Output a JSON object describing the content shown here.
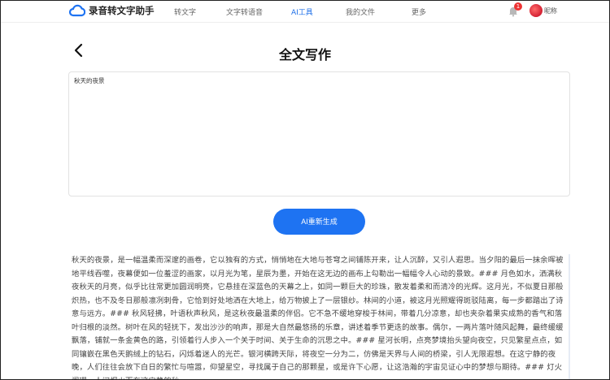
{
  "app": {
    "logo_text": "录音转文字助手"
  },
  "nav": {
    "items": [
      {
        "label": "转文字",
        "active": false
      },
      {
        "label": "文字转语音",
        "active": false
      },
      {
        "label": "AI工具",
        "active": true
      },
      {
        "label": "我的文件",
        "active": false
      },
      {
        "label": "更多",
        "active": false
      }
    ]
  },
  "user": {
    "notifications": "1",
    "nickname": "昵称"
  },
  "page": {
    "title": "全文写作"
  },
  "input": {
    "value": "秋天的夜景"
  },
  "actions": {
    "regenerate_label": "AI重新生成"
  },
  "result": {
    "text": "秋天的夜景，是一幅温柔而深邃的画卷，它以独有的方式，悄悄地在大地与苍穹之间铺陈开来，让人沉醉，又引人遐思。当夕阳的最后一抹余晖被地平线吞噬，夜幕便如一位羞涩的画家，以月光为笔，星辰为墨，开始在这无边的画布上勾勒出一幅幅令人心动的景致。### 月色如水，洒满秋夜秋天的月亮，似乎比往常更加圆润明亮，它悬挂在深蓝色的天幕之上，如同一颗巨大的珍珠，散发着柔和而清冷的光辉。这月光，不似夏日那般炽热，也不及冬日那般凛冽刺骨，它恰到好处地洒在大地上，给万物披上了一层银纱。林间的小道，被这月光照耀得斑驳陆离，每一步都踏出了诗意与远方。### 秋风轻拂，叶语秋声秋风，是这秋夜最温柔的伴侣。它不急不缓地穿梭于林间，带着几分凉意，却也夹杂着果实成熟的香气和落叶归根的淡然。树叶在风的轻抚下，发出沙沙的响声，那是大自然最悠扬的乐章，讲述着季节更迭的故事。偶尔，一两片落叶随风起舞，最终缓缓飘落，铺就一条金黄色的路，引领着行人步入一个关于时间、关于生命的沉思之中。### 星河长明，点亮梦境抬头望向夜空，只见繁星点点，如同镶嵌在黑色天鹅绒上的钻石，闪烁着迷人的光芒。银河横跨天际，将夜空一分为二，仿佛是天界与人间的桥梁，引人无限遐想。在这宁静的夜晚，人们往往会放下白日的繁忙与喧嚣，仰望星空，寻找属于自己的那颗星，或是许下心愿，让这浩瀚的宇宙见证心中的梦想与期待。### 灯火阑珊，人间烟火而在这宁静的秋"
  },
  "colors": {
    "accent": "#1e73f2",
    "badge": "#ee3333"
  }
}
